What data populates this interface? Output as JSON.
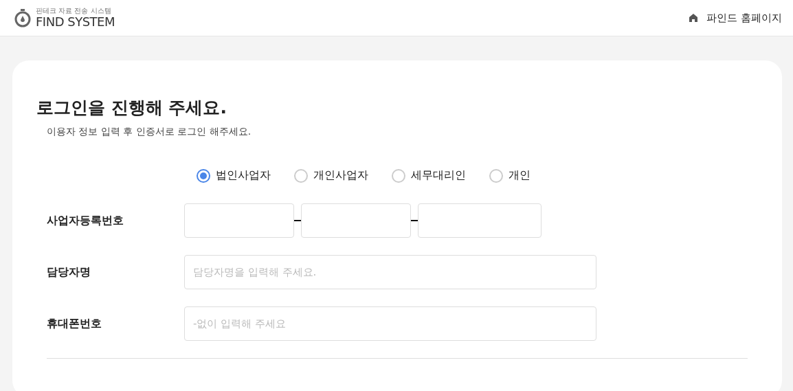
{
  "header": {
    "logo_subtitle": "핀테크 자료 전송 시스템",
    "logo_title": "FIND SYSTEM",
    "home_link": "파인드 홈페이지"
  },
  "login": {
    "title": "로그인을 진행해 주세요.",
    "subtitle": "이용자 정보 입력 후 인증서로 로그인 해주세요.",
    "user_types": [
      {
        "label": "법인사업자",
        "selected": true
      },
      {
        "label": "개인사업자",
        "selected": false
      },
      {
        "label": "세무대리인",
        "selected": false
      },
      {
        "label": "개인",
        "selected": false
      }
    ],
    "fields": [
      {
        "kind": "split",
        "label": "사업자등록번호"
      },
      {
        "kind": "text",
        "label": "담당자명",
        "placeholder": "담당자명을 입력해 주세요."
      },
      {
        "kind": "text",
        "label": "휴대폰번호",
        "placeholder": "-없이 입력해 주세요"
      }
    ]
  }
}
